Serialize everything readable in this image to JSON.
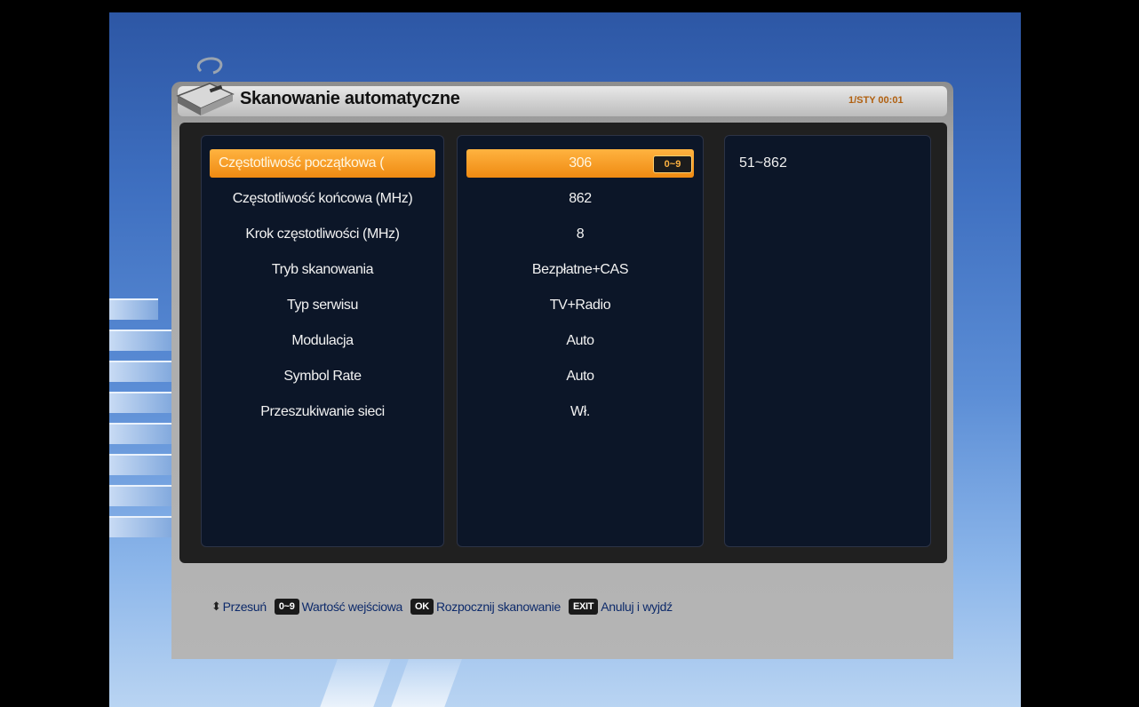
{
  "header": {
    "title": "Skanowanie automatyczne",
    "datetime": "1/STY 00:01"
  },
  "rows": [
    {
      "label": "Częstotliwość początkowa (",
      "value": "306",
      "selected": true
    },
    {
      "label": "Częstotliwość końcowa (MHz)",
      "value": "862"
    },
    {
      "label": "Krok częstotliwości (MHz)",
      "value": "8"
    },
    {
      "label": "Tryb skanowania",
      "value": "Bezpłatne+CAS"
    },
    {
      "label": "Typ serwisu",
      "value": "TV+Radio"
    },
    {
      "label": "Modulacja",
      "value": "Auto"
    },
    {
      "label": "Symbol Rate",
      "value": "Auto"
    },
    {
      "label": "Przeszukiwanie sieci",
      "value": "Wł."
    }
  ],
  "input_hint": "0~9",
  "info": {
    "range": "51~862"
  },
  "help": {
    "move_icon": "up-down-arrows-icon",
    "move_label": "Przesuń",
    "digits_key": "0~9",
    "digits_label": "Wartość wejściowa",
    "ok_key": "OK",
    "ok_label": "Rozpocznij skanowanie",
    "exit_key": "EXIT",
    "exit_label": "Anuluj i wyjdź"
  },
  "colors": {
    "highlight": "#ef8a12",
    "panel": "#0c1628",
    "frame": "#b5b5b5"
  }
}
